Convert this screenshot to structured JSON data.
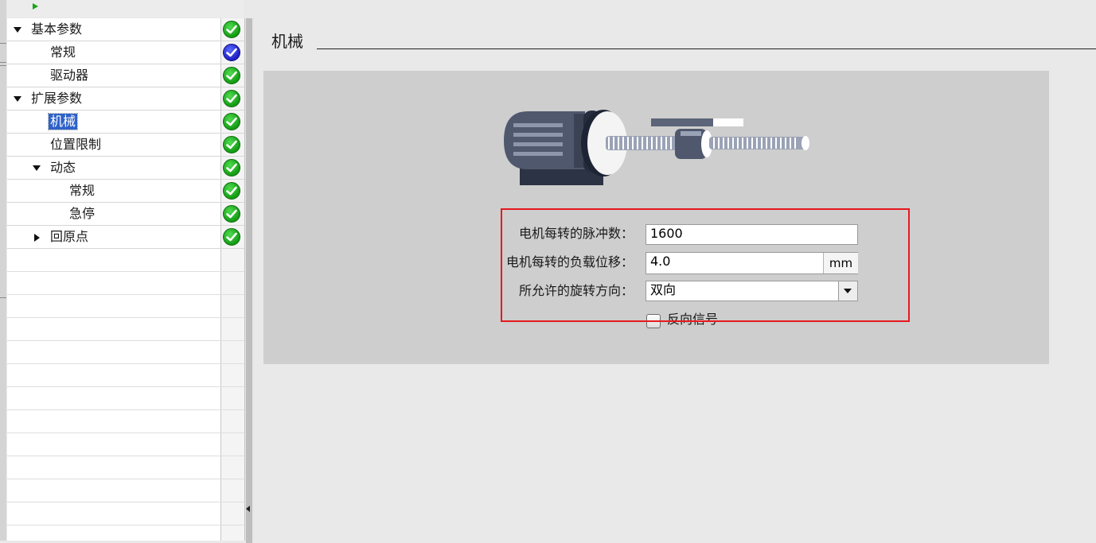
{
  "tree": {
    "items": [
      {
        "label": "基本参数",
        "expander": "down",
        "status": "ok"
      },
      {
        "label": "常规",
        "expander": "none",
        "status": "info"
      },
      {
        "label": "驱动器",
        "expander": "none",
        "status": "ok"
      },
      {
        "label": "扩展参数",
        "expander": "down",
        "status": "ok"
      },
      {
        "label": "机械",
        "expander": "none",
        "status": "ok",
        "selected": true
      },
      {
        "label": "位置限制",
        "expander": "none",
        "status": "ok"
      },
      {
        "label": "动态",
        "expander": "down",
        "status": "ok"
      },
      {
        "label": "常规",
        "expander": "none",
        "status": "ok"
      },
      {
        "label": "急停",
        "expander": "none",
        "status": "ok"
      },
      {
        "label": "回原点",
        "expander": "right",
        "status": "ok"
      }
    ]
  },
  "section": {
    "title": "机械"
  },
  "form": {
    "pulses_label": "电机每转的脉冲数：",
    "pulses_value": "1600",
    "displacement_label": "电机每转的负载位移：",
    "displacement_value": "4.0",
    "displacement_unit": "mm",
    "direction_label": "所允许的旋转方向：",
    "direction_value": "双向",
    "invert_signal_label": "反向信号",
    "invert_signal_checked": false
  },
  "colors": {
    "selection": "#2e62c8",
    "status_ok": "#149a14",
    "status_info": "#1d1ec4",
    "highlight_box": "#e8181f",
    "panel_bg": "#cecece"
  },
  "icons": {
    "tree_run": "play-icon",
    "status_ok": "check-circle-green-icon",
    "status_info": "check-circle-blue-icon",
    "illustration": "motor-ballscrew-illustration"
  }
}
